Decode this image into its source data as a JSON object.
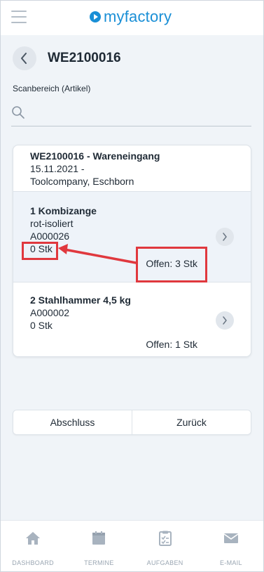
{
  "header": {
    "logo_text": "myfactory",
    "menu_icon": "hamburger-icon",
    "brand_color": "#1a8fd6"
  },
  "page": {
    "title": "WE2100016",
    "back_icon": "chevron-left-icon"
  },
  "scan": {
    "label": "Scanbereich (Artikel)",
    "value": "",
    "placeholder": "",
    "icon": "search-icon"
  },
  "card": {
    "title": "WE2100016 - Wareneingang",
    "date": "15.11.2021 -",
    "supplier": "Toolcompany, Eschborn",
    "items": [
      {
        "name": "1 Kombizange",
        "description": "rot-isoliert",
        "article": "A000026",
        "quantity": "0 Stk",
        "open": "Offen: 3 Stk"
      },
      {
        "name": "2 Stahlhammer 4,5 kg",
        "article": "A000002",
        "quantity": "0 Stk",
        "open": "Offen: 1 Stk"
      }
    ]
  },
  "actions": {
    "close_label": "Abschluss",
    "back_label": "Zurück"
  },
  "bottom_nav": [
    {
      "label": "DASHBOARD",
      "icon": "home-icon"
    },
    {
      "label": "TERMINE",
      "icon": "calendar-icon"
    },
    {
      "label": "AUFGABEN",
      "icon": "clipboard-icon"
    },
    {
      "label": "E-MAIL",
      "icon": "mail-icon"
    }
  ],
  "colors": {
    "annotation": "#e0383e",
    "background": "#f0f4f8",
    "selected_row": "#eef3f9",
    "nav_icon": "#a8b3bf"
  }
}
